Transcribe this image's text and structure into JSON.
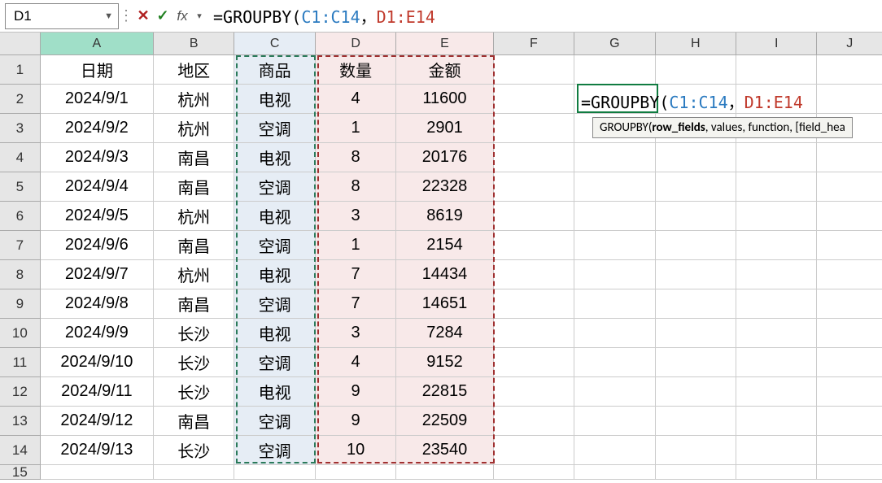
{
  "name_box": "D1",
  "formula": {
    "pre": "=GROUPBY(",
    "ref1": "C1:C14",
    "sep": "，",
    "ref2": "D1:E14"
  },
  "col_labels": [
    "A",
    "B",
    "C",
    "D",
    "E",
    "F",
    "G",
    "H",
    "I",
    "J"
  ],
  "headers": [
    "日期",
    "地区",
    "商品",
    "数量",
    "金额"
  ],
  "rows": [
    [
      "2024/9/1",
      "杭州",
      "电视",
      "4",
      "11600"
    ],
    [
      "2024/9/2",
      "杭州",
      "空调",
      "1",
      "2901"
    ],
    [
      "2024/9/3",
      "南昌",
      "电视",
      "8",
      "20176"
    ],
    [
      "2024/9/4",
      "南昌",
      "空调",
      "8",
      "22328"
    ],
    [
      "2024/9/5",
      "杭州",
      "电视",
      "3",
      "8619"
    ],
    [
      "2024/9/6",
      "南昌",
      "空调",
      "1",
      "2154"
    ],
    [
      "2024/9/7",
      "杭州",
      "电视",
      "7",
      "14434"
    ],
    [
      "2024/9/8",
      "南昌",
      "空调",
      "7",
      "14651"
    ],
    [
      "2024/9/9",
      "长沙",
      "电视",
      "3",
      "7284"
    ],
    [
      "2024/9/10",
      "长沙",
      "空调",
      "4",
      "9152"
    ],
    [
      "2024/9/11",
      "长沙",
      "电视",
      "9",
      "22815"
    ],
    [
      "2024/9/12",
      "南昌",
      "空调",
      "9",
      "22509"
    ],
    [
      "2024/9/13",
      "长沙",
      "空调",
      "10",
      "23540"
    ]
  ],
  "g2": {
    "pre": "=GROUPBY(",
    "ref1": "C1:C14",
    "sep": "，",
    "ref2": "D1:E14"
  },
  "tooltip": {
    "fn": "GROUPBY(",
    "bold": "row_fields",
    "rest": ", values, function, [field_hea"
  },
  "colors": {
    "ref1": "#2a7ac0",
    "ref2": "#c0392b"
  }
}
